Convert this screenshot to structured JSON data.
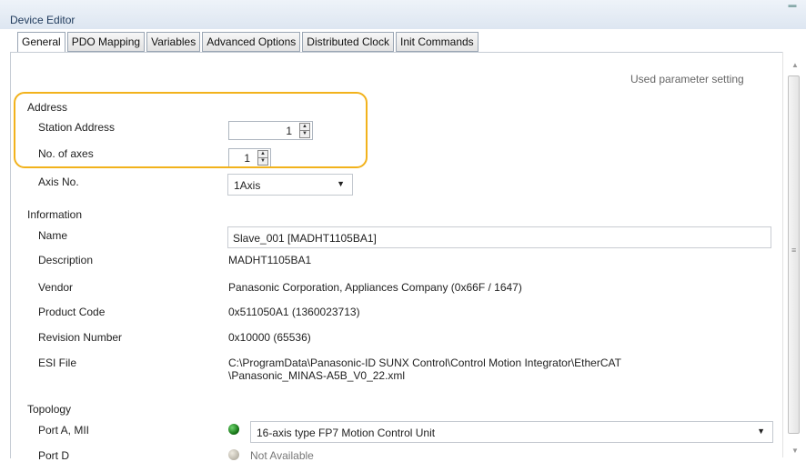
{
  "window": {
    "title": "Device Editor"
  },
  "tabs": [
    {
      "label": "General",
      "active": true
    },
    {
      "label": "PDO Mapping"
    },
    {
      "label": "Variables"
    },
    {
      "label": "Advanced Options"
    },
    {
      "label": "Distributed Clock"
    },
    {
      "label": "Init Commands"
    }
  ],
  "mode_note": "Used parameter setting",
  "address": {
    "section_label": "Address",
    "station_address": {
      "label": "Station Address",
      "value": "1"
    },
    "num_axes": {
      "label": "No. of axes",
      "value": "1"
    },
    "axis_no": {
      "label": "Axis No.",
      "value": "1Axis"
    }
  },
  "information": {
    "section_label": "Information",
    "name": {
      "label": "Name",
      "value": "Slave_001 [MADHT1105BA1]"
    },
    "description": {
      "label": "Description",
      "value": "MADHT1105BA1"
    },
    "vendor": {
      "label": "Vendor",
      "value": "Panasonic Corporation, Appliances Company (0x66F / 1647)"
    },
    "product_code": {
      "label": "Product Code",
      "value": "0x511050A1 (1360023713)"
    },
    "revision_number": {
      "label": "Revision Number",
      "value": "0x10000 (65536)"
    },
    "esi_file": {
      "label": "ESI File",
      "line1": "C:\\ProgramData\\Panasonic-ID SUNX Control\\Control Motion Integrator\\EtherCAT",
      "line2": "\\Panasonic_MINAS-A5B_V0_22.xml"
    }
  },
  "topology": {
    "section_label": "Topology",
    "port_a": {
      "label": "Port A, MII",
      "value": "16-axis type FP7 Motion Control Unit",
      "status_color": "#1a7a1a"
    },
    "port_d": {
      "label": "Port D",
      "value": "Not Available",
      "status_color": "#b9b4a8"
    }
  },
  "colors": {
    "highlight": "#f2b21c",
    "accent": "#1e395b"
  }
}
